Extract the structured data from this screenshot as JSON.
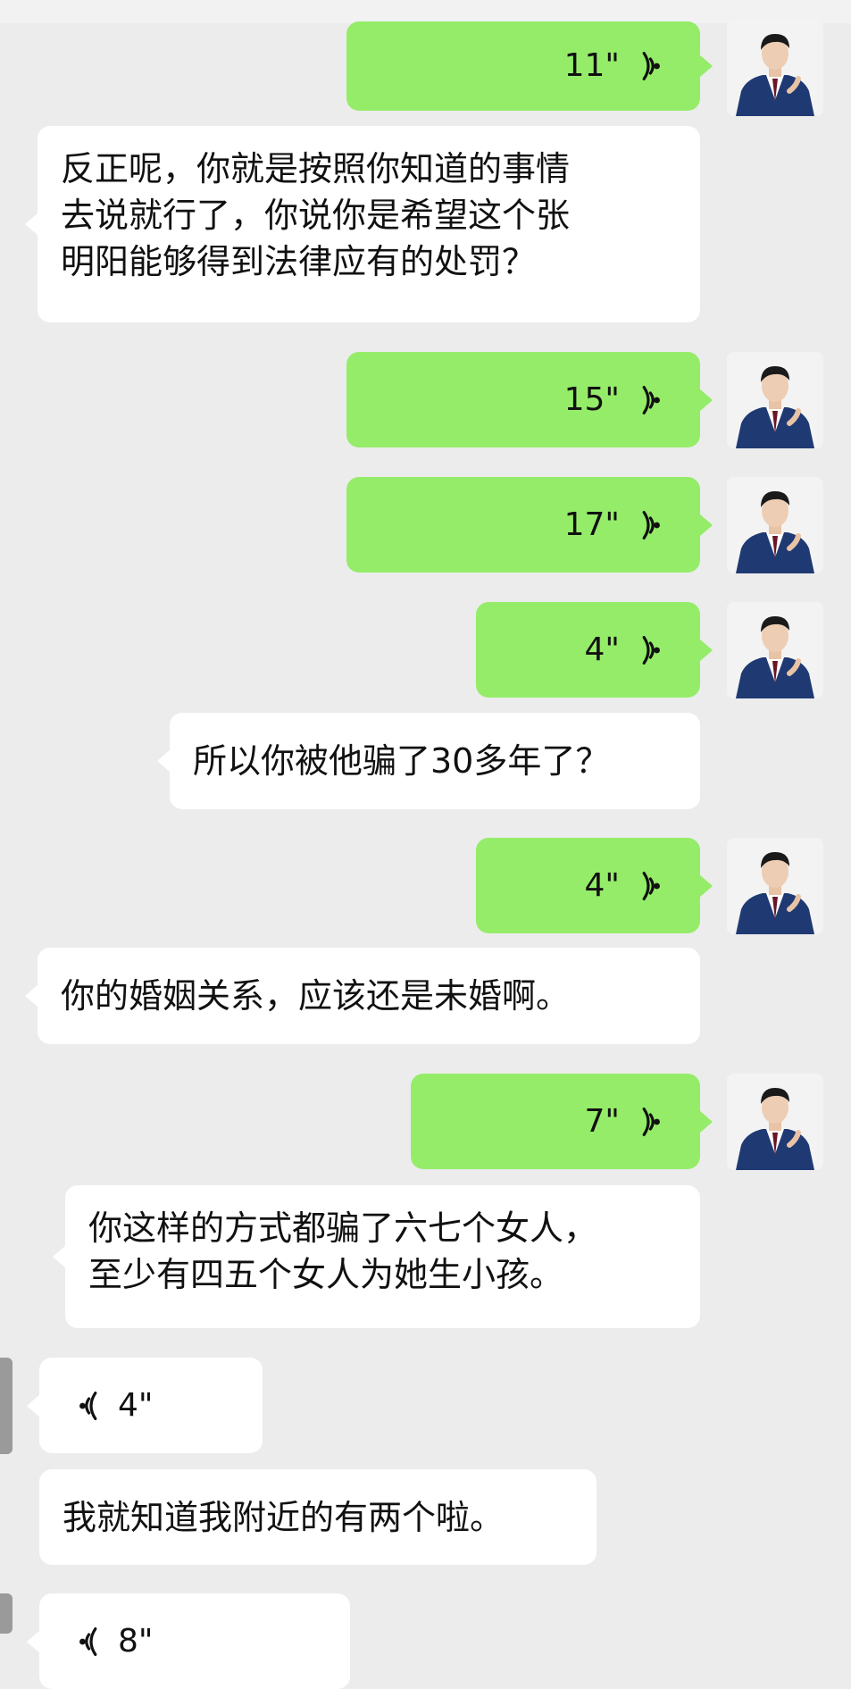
{
  "colors": {
    "background": "#ececec",
    "outgoing_bubble": "#95ec69",
    "incoming_bubble": "#ffffff"
  },
  "messages": {
    "m1": {
      "duration": "11\""
    },
    "m2": {
      "lines": [
        "反正呢，你就是按照你知道的事情",
        "去说就行了，你说你是希望这个张",
        "明阳能够得到法律应有的处罚？"
      ]
    },
    "m3": {
      "duration": "15\""
    },
    "m4": {
      "duration": "17\""
    },
    "m5": {
      "duration": "4\""
    },
    "m6": {
      "text": "所以你被他骗了30多年了？"
    },
    "m7": {
      "duration": "4\""
    },
    "m8": {
      "text": "你的婚姻关系，应该还是未婚啊。"
    },
    "m9": {
      "duration": "7\""
    },
    "m10": {
      "lines": [
        "你这样的方式都骗了六七个女人，",
        "至少有四五个女人为她生小孩。"
      ]
    },
    "m11": {
      "duration": "4\""
    },
    "m12": {
      "text": "我就知道我附近的有两个啦。"
    },
    "m13": {
      "duration": "8\""
    }
  },
  "icons": {
    "outgoing_voice": "voice-wave-icon",
    "incoming_voice": "voice-wave-icon",
    "avatar": "user-avatar-man-in-suit"
  }
}
